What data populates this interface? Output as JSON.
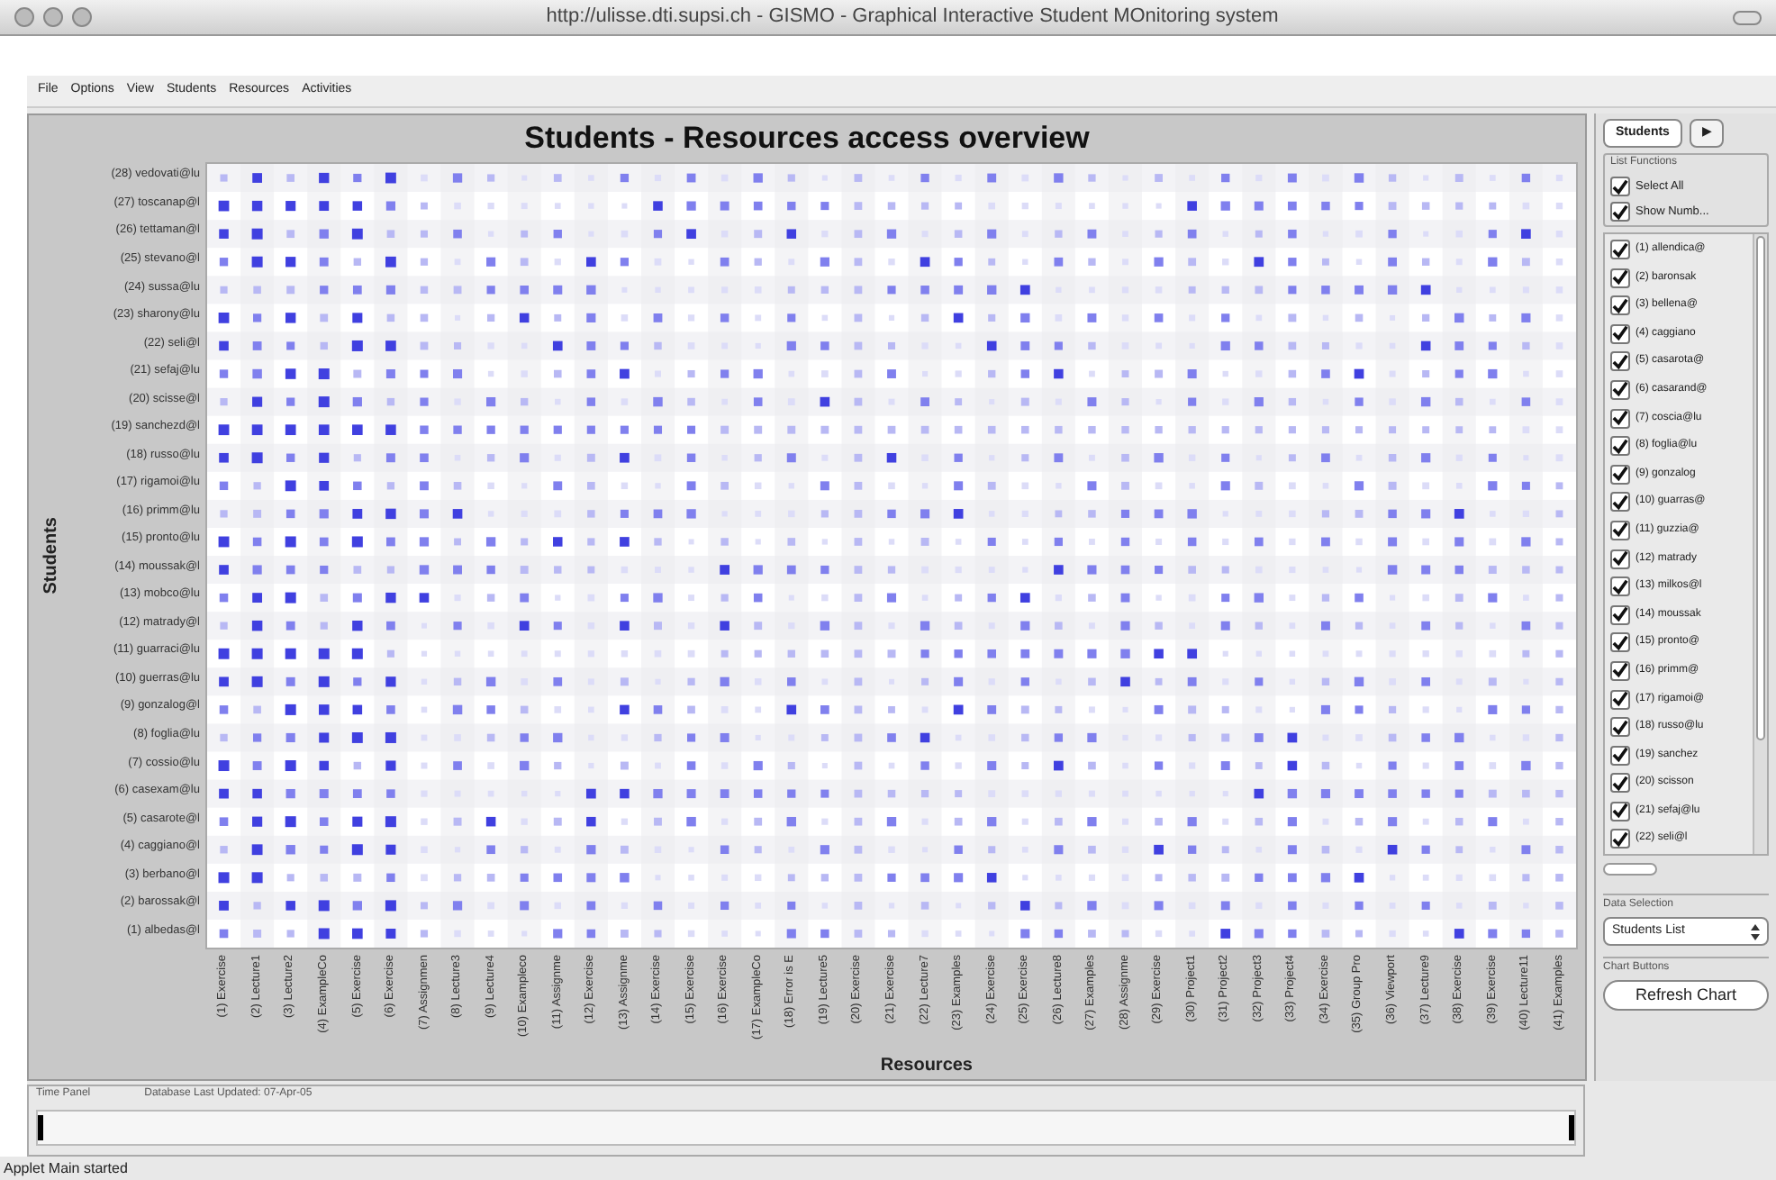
{
  "window": {
    "title": "http://ulisse.dti.supsi.ch - GISMO - Graphical Interactive Student MOnitoring system"
  },
  "menu": [
    "File",
    "Options",
    "View",
    "Students",
    "Resources",
    "Activities"
  ],
  "chart": {
    "title": "Students - Resources access overview",
    "ylabel": "Students",
    "xlabel": "Resources",
    "students": [
      "(28) vedovati@lu",
      "(27) toscanap@l",
      "(26) tettaman@l",
      "(25) stevano@l",
      "(24) sussa@lu",
      "(23) sharony@lu",
      "(22) seli@l",
      "(21) sefaj@lu",
      "(20) scisse@l",
      "(19) sanchezd@l",
      "(18) russo@lu",
      "(17) rigamoi@lu",
      "(16) primm@lu",
      "(15) pronto@lu",
      "(14) moussak@l",
      "(13) mobco@lu",
      "(12) matrady@l",
      "(11) guarraci@lu",
      "(10) guerras@lu",
      "(9) gonzalog@l",
      "(8) foglia@lu",
      "(7) cossio@lu",
      "(6) casexam@lu",
      "(5) casarote@l",
      "(4) caggiano@l",
      "(3) berbano@l",
      "(2) barossak@l",
      "(1) albedas@l"
    ],
    "resources": [
      "(1) Exercise",
      "(2) Lecture1",
      "(3) Lecture2",
      "(4) ExampleCo",
      "(5) Exercise",
      "(6) Exercise",
      "(7) Assignmen",
      "(8) Lecture3",
      "(9) Lecture4",
      "(10) Exampleco",
      "(11) Assignme",
      "(12) Exercise",
      "(13) Assignme",
      "(14) Exercise",
      "(15) Exercise",
      "(16) Exercise",
      "(17) ExampleCo",
      "(18) Error is E",
      "(19) Lecture5",
      "(20) Exercise",
      "(21) Exercise",
      "(22) Lecture7",
      "(23) Examples",
      "(24) Exercise",
      "(25) Exercise",
      "(26) Lecture8",
      "(27) Examples",
      "(28) Assignme",
      "(29) Exercise",
      "(30) Project1",
      "(31) Project2",
      "(32) Project3",
      "(33) Project4",
      "(34) Exercise",
      "(35) Group Pro",
      "(36) Viewport",
      "(37) Lecture9",
      "(38) Exercise",
      "(39) Exercise",
      "(40) Lecture11",
      "(41) Examples"
    ]
  },
  "side": {
    "tabs": [
      {
        "label": "Students",
        "selected": true
      },
      {
        "label": "▶",
        "selected": false
      }
    ],
    "list_functions": {
      "title": "List Functions",
      "items": [
        {
          "label": "Select All",
          "checked": true
        },
        {
          "label": "Show Numb...",
          "checked": true
        }
      ]
    },
    "students": [
      {
        "label": "(1) allendica@",
        "checked": true
      },
      {
        "label": "(2) baronsak",
        "checked": true
      },
      {
        "label": "(3) bellena@",
        "checked": true
      },
      {
        "label": "(4) caggiano",
        "checked": true
      },
      {
        "label": "(5) casarota@",
        "checked": true
      },
      {
        "label": "(6) casarand@",
        "checked": true
      },
      {
        "label": "(7) coscia@lu",
        "checked": true
      },
      {
        "label": "(8) foglia@lu",
        "checked": true
      },
      {
        "label": "(9) gonzalog",
        "checked": true
      },
      {
        "label": "(10) guarras@",
        "checked": true
      },
      {
        "label": "(11) guzzia@",
        "checked": true
      },
      {
        "label": "(12) matrady",
        "checked": true
      },
      {
        "label": "(13) milkos@l",
        "checked": true
      },
      {
        "label": "(14) moussak",
        "checked": true
      },
      {
        "label": "(15) pronto@",
        "checked": true
      },
      {
        "label": "(16) primm@",
        "checked": true
      },
      {
        "label": "(17) rigamoi@",
        "checked": true
      },
      {
        "label": "(18) russo@lu",
        "checked": true
      },
      {
        "label": "(19) sanchez",
        "checked": true
      },
      {
        "label": "(20) scisson",
        "checked": true
      },
      {
        "label": "(21) sefaj@lu",
        "checked": true
      },
      {
        "label": "(22) seli@l",
        "checked": true
      }
    ],
    "data_selection": {
      "title": "Data Selection",
      "value": "Students List"
    },
    "chart_buttons": {
      "title": "Chart Buttons",
      "button": "Refresh Chart"
    }
  },
  "time_panel": {
    "title": "Time Panel",
    "updated": "Database Last Updated: 07-Apr-05",
    "level": 1
  },
  "status_bar": "Applet Main started"
}
